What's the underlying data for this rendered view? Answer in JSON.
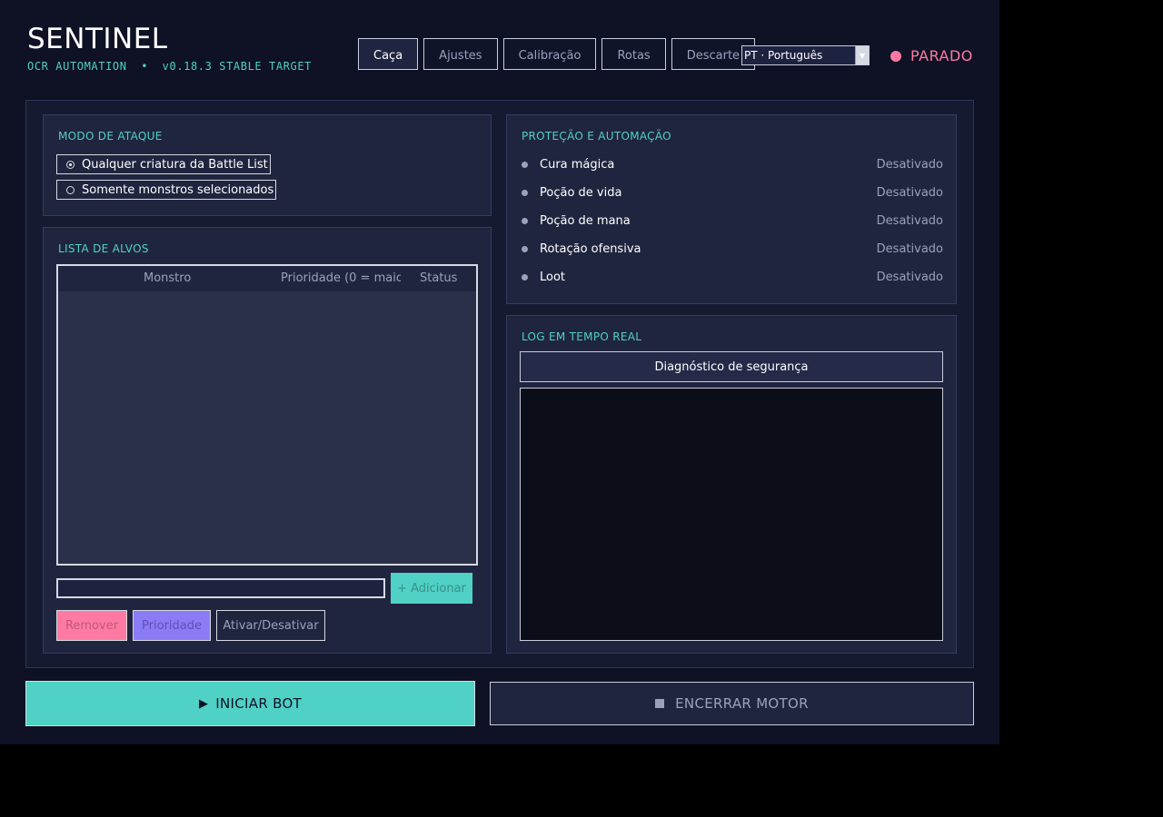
{
  "app": {
    "title": "SENTINEL",
    "subtitle": "OCR AUTOMATION  •  v0.18.3 STABLE TARGET"
  },
  "tabs": [
    {
      "label": "Caça",
      "active": true
    },
    {
      "label": "Ajustes"
    },
    {
      "label": "Calibração"
    },
    {
      "label": "Rotas"
    },
    {
      "label": "Descarte"
    }
  ],
  "language": {
    "selected": "PT · Português",
    "arrow_icon": "chevron-down-icon"
  },
  "status": {
    "label": "PARADO",
    "color": "#ff7aa2"
  },
  "attack_mode": {
    "title": "MODO DE ATAQUE",
    "options": [
      {
        "label": "Qualquer criatura da Battle List",
        "selected": true
      },
      {
        "label": "Somente monstros selecionados",
        "selected": false
      }
    ]
  },
  "targets": {
    "title": "LISTA DE ALVOS",
    "columns": [
      "Monstro",
      "Prioridade (0 = maior",
      "Status"
    ],
    "rows": [],
    "input_value": "",
    "add_label": "+ Adicionar",
    "remove_label": "Remover",
    "priority_label": "Prioridade",
    "toggle_label": "Ativar/Desativar"
  },
  "protection": {
    "title": "PROTEÇÃO E AUTOMAÇÃO",
    "items": [
      {
        "name": "Cura mágica",
        "state": "Desativado"
      },
      {
        "name": "Poção de vida",
        "state": "Desativado"
      },
      {
        "name": "Poção de mana",
        "state": "Desativado"
      },
      {
        "name": "Rotação ofensiva",
        "state": "Desativado"
      },
      {
        "name": "Loot",
        "state": "Desativado"
      }
    ]
  },
  "log": {
    "title": "LOG EM TEMPO REAL",
    "diagnostic_label": "Diagnóstico de segurança",
    "entries": []
  },
  "footer": {
    "start_label": "INICIAR BOT",
    "start_icon": "play-icon",
    "stop_label": "ENCERRAR MOTOR",
    "stop_icon": "stop-icon"
  },
  "colors": {
    "accent": "#4fd1c5",
    "danger": "#ff7aa2",
    "purple": "#8b7cf6",
    "background": "#0e1224"
  }
}
